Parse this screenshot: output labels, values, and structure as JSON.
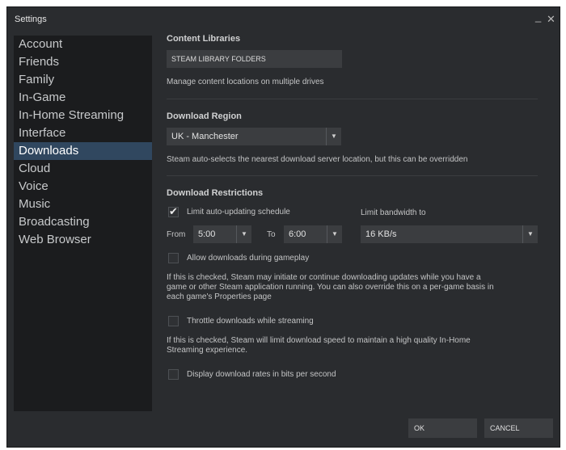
{
  "window": {
    "title": "Settings",
    "minimize_glyph": "_",
    "close_glyph": "✕"
  },
  "sidebar": {
    "items": [
      {
        "label": "Account"
      },
      {
        "label": "Friends"
      },
      {
        "label": "Family"
      },
      {
        "label": "In-Game"
      },
      {
        "label": "In-Home Streaming"
      },
      {
        "label": "Interface"
      },
      {
        "label": "Downloads",
        "active": true
      },
      {
        "label": "Cloud"
      },
      {
        "label": "Voice"
      },
      {
        "label": "Music"
      },
      {
        "label": "Broadcasting"
      },
      {
        "label": "Web Browser"
      }
    ]
  },
  "content_libraries": {
    "heading": "Content Libraries",
    "button": "STEAM LIBRARY FOLDERS",
    "description": "Manage content locations on multiple drives"
  },
  "download_region": {
    "heading": "Download Region",
    "selected": "UK - Manchester",
    "description": "Steam auto-selects the nearest download server location, but this can be overridden"
  },
  "restrictions": {
    "heading": "Download Restrictions",
    "limit_schedule": {
      "label": "Limit auto-updating schedule",
      "checked": true
    },
    "from_label": "From",
    "from_value": "5:00",
    "to_label": "To",
    "to_value": "6:00",
    "bandwidth_label": "Limit bandwidth to",
    "bandwidth_value": "16 KB/s",
    "allow_gameplay": {
      "label": "Allow downloads during gameplay",
      "checked": false,
      "description_lines": [
        "If this is checked, Steam may initiate or continue downloading updates while you have a",
        "game or other Steam application running. You can also override this on a per-game basis in",
        "each game's Properties page"
      ]
    },
    "throttle": {
      "label": "Throttle downloads while streaming",
      "checked": false,
      "description_lines": [
        "If this is checked, Steam will limit download speed to maintain a high quality In-Home",
        "Streaming experience."
      ]
    },
    "bits": {
      "label": "Display download rates in bits per second",
      "checked": false
    }
  },
  "footer": {
    "ok": "OK",
    "cancel": "CANCEL"
  },
  "colors": {
    "window_bg": "#2a2c2f",
    "sidebar_bg": "#1b1c1e",
    "active_nav": "#30475f",
    "control_bg": "#3b3d40"
  },
  "icons": {
    "dropdown": "chevron-down-icon",
    "check": "checkmark-icon"
  }
}
